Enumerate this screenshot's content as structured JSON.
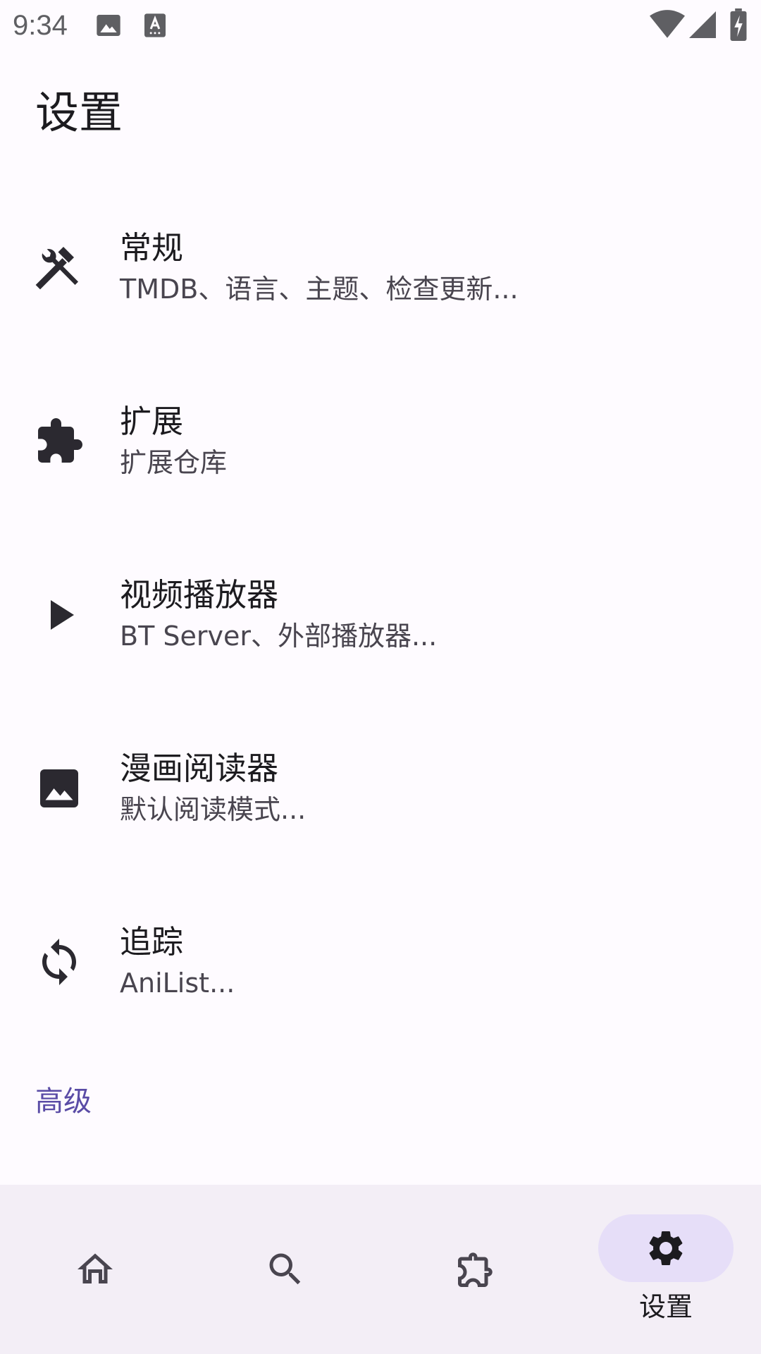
{
  "status_bar": {
    "time": "9:34",
    "icons": [
      "image-icon",
      "text-recognition-icon",
      "wifi-icon",
      "cellular-signal-icon",
      "battery-charging-icon"
    ]
  },
  "header": {
    "title": "设置"
  },
  "settings": {
    "items": [
      {
        "icon": "tools-icon",
        "title": "常规",
        "subtitle": "TMDB、语言、主题、检查更新..."
      },
      {
        "icon": "extension-icon",
        "title": "扩展",
        "subtitle": "扩展仓库"
      },
      {
        "icon": "play-icon",
        "title": "视频播放器",
        "subtitle": "BT Server、外部播放器..."
      },
      {
        "icon": "image-icon",
        "title": "漫画阅读器",
        "subtitle": "默认阅读模式..."
      },
      {
        "icon": "sync-icon",
        "title": "追踪",
        "subtitle": "AniList..."
      }
    ],
    "section_header": "高级"
  },
  "bottom_nav": {
    "items": [
      {
        "icon": "home-icon",
        "label": ""
      },
      {
        "icon": "search-icon",
        "label": ""
      },
      {
        "icon": "extension-outline-icon",
        "label": ""
      },
      {
        "icon": "gear-icon",
        "label": "设置",
        "selected": true
      }
    ]
  },
  "colors": {
    "background": "#FEFBFF",
    "nav_background": "#F3EEF6",
    "selected_pill": "#E6DEF8",
    "accent": "#5A4CA6",
    "text_primary": "#1C1B1F",
    "text_secondary": "#49454F"
  }
}
